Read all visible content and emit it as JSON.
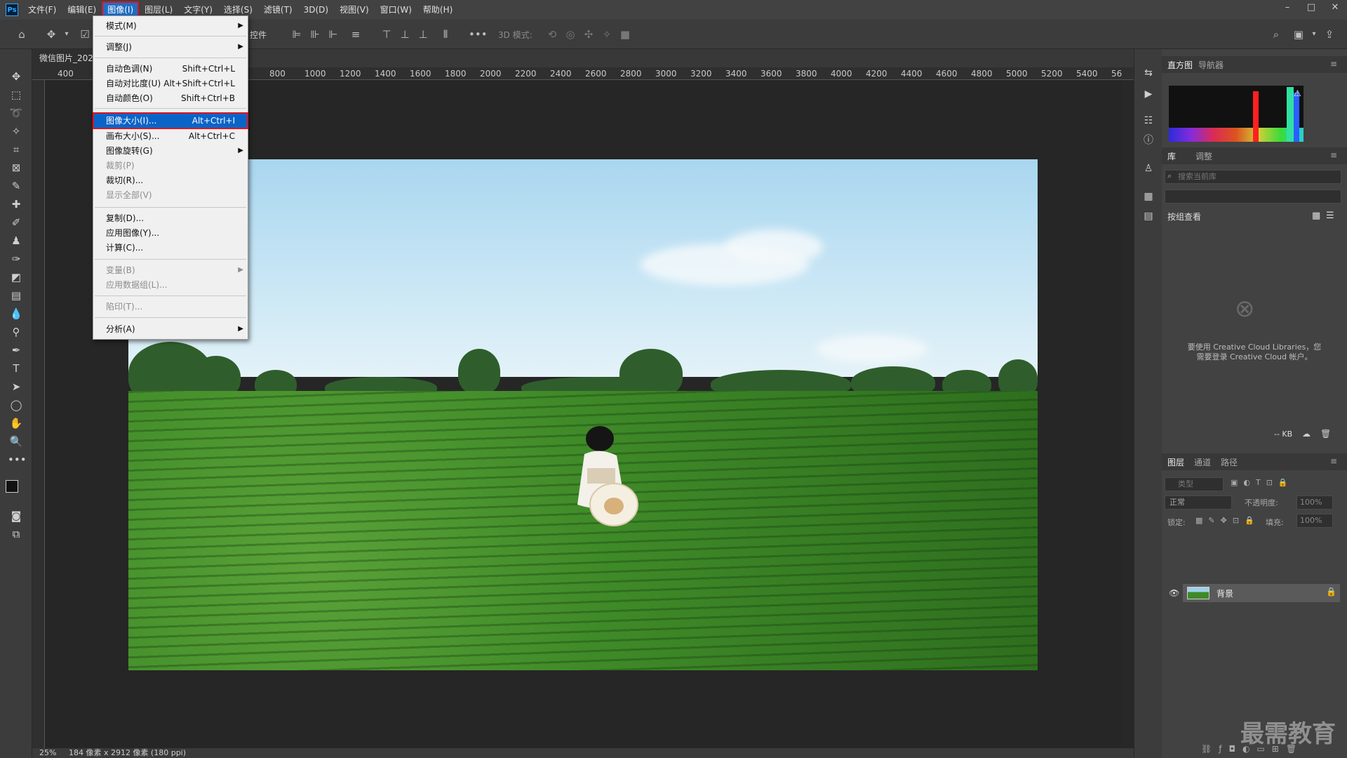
{
  "menubar": {
    "logo": "Ps",
    "items": [
      "文件(F)",
      "编辑(E)",
      "图像(I)",
      "图层(L)",
      "文字(Y)",
      "选择(S)",
      "滤镜(T)",
      "3D(D)",
      "视图(V)",
      "窗口(W)",
      "帮助(H)"
    ]
  },
  "optionsbar": {
    "partial_label": "控件",
    "mode3d_label": "3D 模式:"
  },
  "document": {
    "tab_title": "微信图片_202"
  },
  "ruler": {
    "h_labels": [
      "400",
      "800",
      "1000",
      "1200",
      "1400",
      "1600",
      "1800",
      "2000",
      "2200",
      "2400",
      "2600",
      "2800",
      "3000",
      "3200",
      "3400",
      "3600",
      "3800",
      "4000",
      "4200",
      "4400",
      "4600",
      "4800",
      "5000",
      "5200",
      "5400",
      "56"
    ]
  },
  "image_menu": {
    "items": [
      {
        "label": "模式(M)",
        "shortcut": "",
        "submenu": true,
        "disabled": false
      },
      {
        "label": "调整(J)",
        "shortcut": "",
        "submenu": true,
        "disabled": false
      },
      {
        "label": "自动色调(N)",
        "shortcut": "Shift+Ctrl+L",
        "submenu": false,
        "disabled": false
      },
      {
        "label": "自动对比度(U)",
        "shortcut": "Alt+Shift+Ctrl+L",
        "submenu": false,
        "disabled": false
      },
      {
        "label": "自动颜色(O)",
        "shortcut": "Shift+Ctrl+B",
        "submenu": false,
        "disabled": false
      },
      {
        "label": "图像大小(I)...",
        "shortcut": "Alt+Ctrl+I",
        "submenu": false,
        "disabled": false,
        "highlighted": true
      },
      {
        "label": "画布大小(S)...",
        "shortcut": "Alt+Ctrl+C",
        "submenu": false,
        "disabled": false
      },
      {
        "label": "图像旋转(G)",
        "shortcut": "",
        "submenu": true,
        "disabled": false
      },
      {
        "label": "裁剪(P)",
        "shortcut": "",
        "submenu": false,
        "disabled": true
      },
      {
        "label": "裁切(R)...",
        "shortcut": "",
        "submenu": false,
        "disabled": false
      },
      {
        "label": "显示全部(V)",
        "shortcut": "",
        "submenu": false,
        "disabled": true
      },
      {
        "label": "复制(D)...",
        "shortcut": "",
        "submenu": false,
        "disabled": false
      },
      {
        "label": "应用图像(Y)...",
        "shortcut": "",
        "submenu": false,
        "disabled": false
      },
      {
        "label": "计算(C)...",
        "shortcut": "",
        "submenu": false,
        "disabled": false
      },
      {
        "label": "变量(B)",
        "shortcut": "",
        "submenu": true,
        "disabled": true
      },
      {
        "label": "应用数据组(L)...",
        "shortcut": "",
        "submenu": false,
        "disabled": true
      },
      {
        "label": "陷印(T)...",
        "shortcut": "",
        "submenu": false,
        "disabled": true
      },
      {
        "label": "分析(A)",
        "shortcut": "",
        "submenu": true,
        "disabled": false
      }
    ]
  },
  "panels": {
    "top_tabs": [
      "直方图",
      "导航器"
    ],
    "lib_tabs": [
      "库",
      "调整"
    ],
    "lib_search_placeholder": "搜索当前库",
    "view_by": "按组查看",
    "cc_message_line1": "要使用 Creative Cloud Libraries，您",
    "cc_message_line2": "需要登录 Creative Cloud 帐户。",
    "kb_label": "-- KB",
    "layer_tabs": [
      "图层",
      "通道",
      "路径"
    ],
    "layer_kind": "类型",
    "blend_mode": "正常",
    "opacity_label": "不透明度:",
    "opacity_value": "100%",
    "lock_label": "锁定:",
    "fill_label": "填充:",
    "fill_value": "100%",
    "layer_name": "背景"
  },
  "status": {
    "zoom": "25%",
    "doc_info": "184 像素 x 2912 像素 (180 ppi)"
  },
  "watermark": "最需教育",
  "colors": {
    "highlight": "#0a64c8",
    "redbox": "#e1131f",
    "ui_bg": "#424242"
  }
}
